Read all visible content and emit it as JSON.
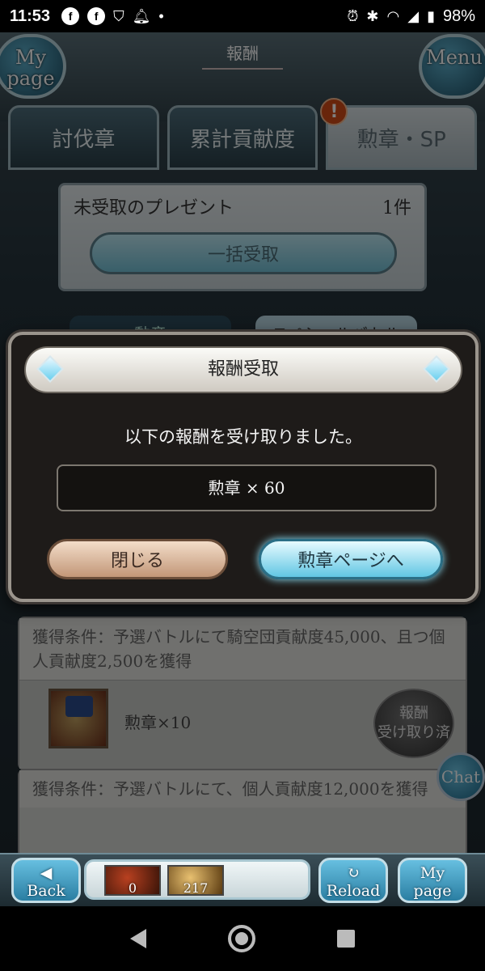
{
  "status_bar": {
    "time": "11:53",
    "battery": "98%",
    "left_icons": [
      "facebook-icon",
      "facebook-icon",
      "shield-icon",
      "bell-icon",
      "dot-icon"
    ],
    "right_icons": [
      "alarm-icon",
      "bluetooth-icon",
      "wifi-icon",
      "signal-icon",
      "battery-icon"
    ]
  },
  "header": {
    "title": "報酬",
    "mypage_label": "My page",
    "menu_label": "Menu"
  },
  "tabs": [
    {
      "label": "討伐章",
      "active": false
    },
    {
      "label": "累計貢献度",
      "active": false
    },
    {
      "label": "勲章・SP",
      "active": true,
      "alert": "!"
    }
  ],
  "present": {
    "label": "未受取のプレゼント",
    "count": "1件",
    "bulk_button": "一括受取"
  },
  "subtabs": [
    {
      "label": "勲章"
    },
    {
      "label": "スペシャルバトル"
    }
  ],
  "cards": [
    {
      "condition": "獲得条件：予選バトルにて騎空団貢献度45,000、且つ個人貢献度2,500を獲得",
      "item": "勲章×10",
      "button": [
        "報酬",
        "受け取り済"
      ]
    },
    {
      "condition": "獲得条件：予選バトルにて、個人貢献度12,000を獲得"
    }
  ],
  "modal": {
    "title": "報酬受取",
    "message": "以下の報酬を受け取りました。",
    "reward": "勲章 × 60",
    "close_button": "閉じる",
    "goto_button": "勲章ページへ"
  },
  "bottom_nav": {
    "back": "Back",
    "reload": "Reload",
    "mypage": "My page",
    "inv1_count": "0",
    "inv2_count": "217",
    "chat": "Chat"
  }
}
